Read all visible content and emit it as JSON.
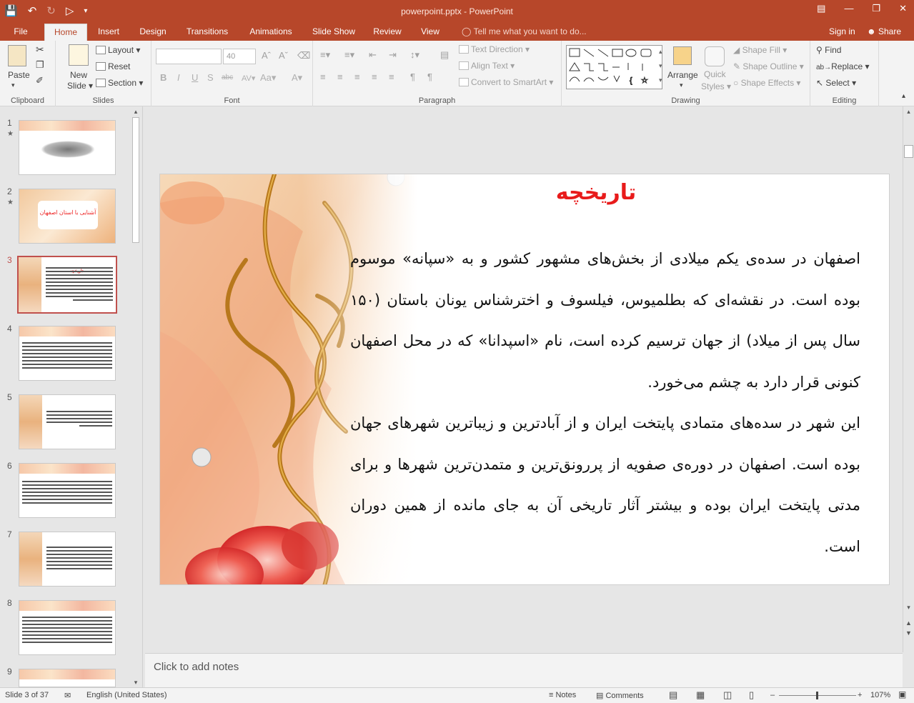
{
  "window": {
    "title": "powerpoint.pptx - PowerPoint"
  },
  "tabs": [
    "File",
    "Home",
    "Insert",
    "Design",
    "Transitions",
    "Animations",
    "Slide Show",
    "Review",
    "View"
  ],
  "tell_me": "Tell me what you want to do...",
  "account": {
    "sign_in": "Sign in",
    "share": "Share"
  },
  "ribbon": {
    "clipboard": {
      "label": "Clipboard",
      "paste": "Paste"
    },
    "slides": {
      "label": "Slides",
      "new_slide_1": "New",
      "new_slide_2": "Slide",
      "layout": "Layout",
      "reset": "Reset",
      "section": "Section"
    },
    "font": {
      "label": "Font",
      "font_name": "",
      "font_size": "40"
    },
    "paragraph": {
      "label": "Paragraph",
      "text_direction": "Text Direction",
      "align_text": "Align Text",
      "convert_smartart": "Convert to SmartArt"
    },
    "drawing": {
      "label": "Drawing",
      "arrange": "Arrange",
      "quick_styles_1": "Quick",
      "quick_styles_2": "Styles",
      "shape_fill": "Shape Fill",
      "shape_outline": "Shape Outline",
      "shape_effects": "Shape Effects"
    },
    "editing": {
      "label": "Editing",
      "find": "Find",
      "replace": "Replace",
      "select": "Select"
    }
  },
  "thumbnails": [
    {
      "num": "1",
      "star": true,
      "title": ""
    },
    {
      "num": "2",
      "star": true,
      "title": "آشنایی با استان اصفهان"
    },
    {
      "num": "3",
      "star": false,
      "title": "تاریخچه",
      "active": true
    },
    {
      "num": "4",
      "star": false,
      "title": ""
    },
    {
      "num": "5",
      "star": false,
      "title": ""
    },
    {
      "num": "6",
      "star": false,
      "title": ""
    },
    {
      "num": "7",
      "star": false,
      "title": ""
    },
    {
      "num": "8",
      "star": false,
      "title": ""
    },
    {
      "num": "9",
      "star": false,
      "title": ""
    }
  ],
  "slide": {
    "title": "تاریخچه",
    "paragraph1": "اصفهان در سده‌ی یکم میلادی از بخش‌های مشهور کشور و به «سپانه» موسوم بوده است. در نقشه‌ای که بطلمیوس، فیلسوف و اخترشناس یونان باستان (۱۵۰ سال پس از میلاد) از جهان ترسیم کرده است، نام «اسپدانا» که در محل اصفهان کنونی قرار دارد به چشم می‌خورد.",
    "paragraph2": "این شهر در سده‌های متمادی پایتخت ایران و از آبادترین و زیباترین شهرهای جهان بوده است. اصفهان در دوره‌ی صفویه از پررونق‌ترین و متمدن‌ترین شهرها و برای مدتی پایتخت ایران بوده و بیشتر آثار تاریخی آن به جای مانده از همین دوران است."
  },
  "notes_placeholder": "Click to add notes",
  "status": {
    "slide_of": "Slide 3 of 37",
    "language": "English (United States)",
    "notes": "Notes",
    "comments": "Comments",
    "zoom": "107%"
  },
  "colors": {
    "accent": "#b7472a",
    "title_red": "#e81b1b",
    "active_thumb": "#c0504d"
  }
}
